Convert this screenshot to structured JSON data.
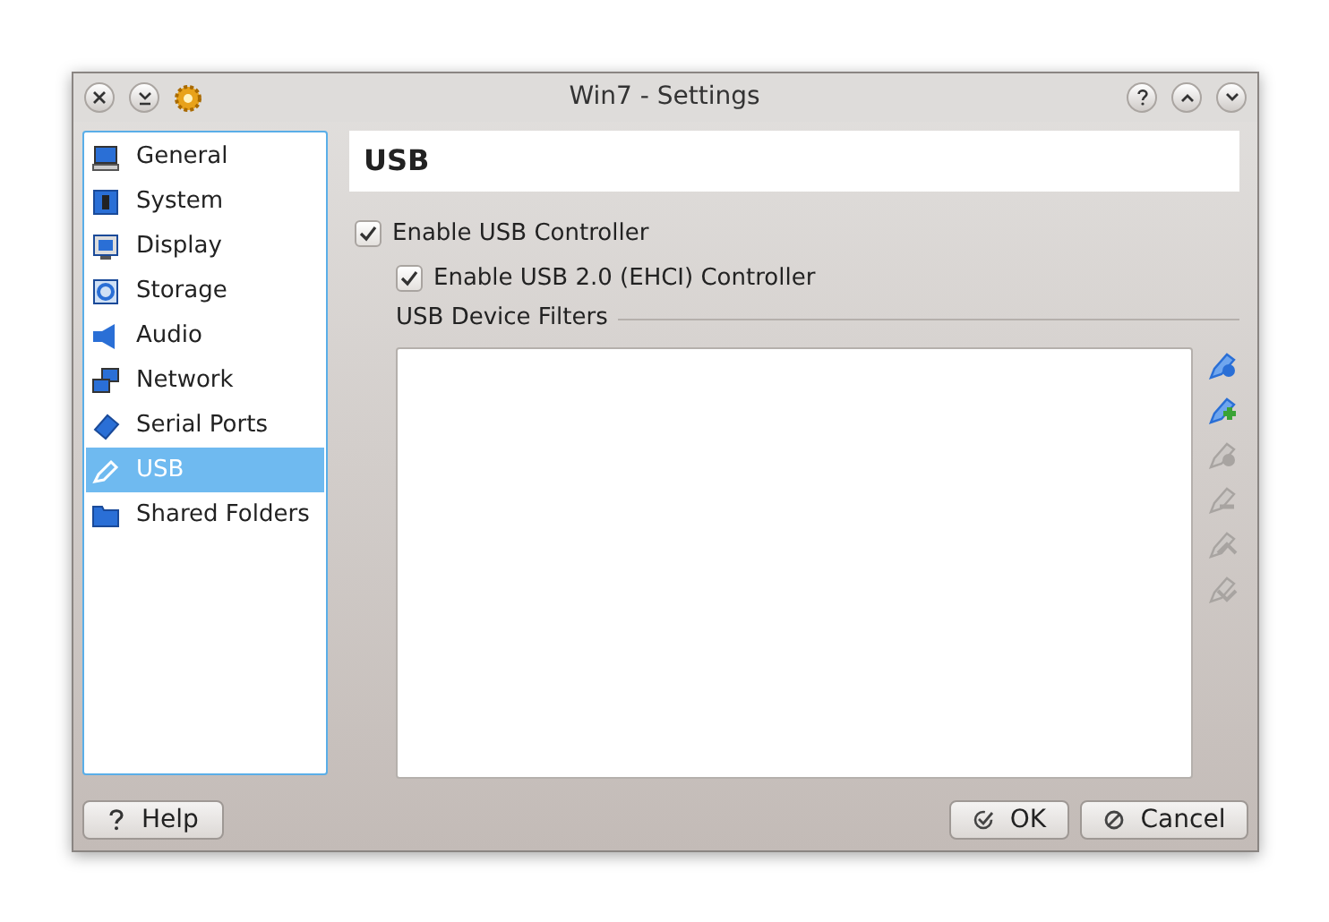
{
  "window": {
    "title": "Win7 - Settings"
  },
  "sidebar": {
    "items": [
      {
        "label": "General",
        "kind": "general",
        "selected": false
      },
      {
        "label": "System",
        "kind": "system",
        "selected": false
      },
      {
        "label": "Display",
        "kind": "display",
        "selected": false
      },
      {
        "label": "Storage",
        "kind": "storage",
        "selected": false
      },
      {
        "label": "Audio",
        "kind": "audio",
        "selected": false
      },
      {
        "label": "Network",
        "kind": "network",
        "selected": false
      },
      {
        "label": "Serial Ports",
        "kind": "serial",
        "selected": false
      },
      {
        "label": "USB",
        "kind": "usb",
        "selected": true
      },
      {
        "label": "Shared Folders",
        "kind": "folder",
        "selected": false
      }
    ]
  },
  "page": {
    "title": "USB",
    "options": [
      {
        "label": "Enable USB Controller",
        "checked": true
      },
      {
        "label": "Enable USB 2.0 (EHCI) Controller",
        "checked": true
      }
    ],
    "filters_label": "USB Device Filters",
    "filter_tools": [
      {
        "kind": "edit",
        "disabled": false
      },
      {
        "kind": "add",
        "disabled": false
      },
      {
        "kind": "remove",
        "disabled": true
      },
      {
        "kind": "minus",
        "disabled": true
      },
      {
        "kind": "up",
        "disabled": true
      },
      {
        "kind": "down",
        "disabled": true
      }
    ]
  },
  "buttons": [
    {
      "label": "Help",
      "kind": "help"
    },
    {
      "label": "OK",
      "kind": "ok"
    },
    {
      "label": "Cancel",
      "kind": "cancel"
    }
  ]
}
